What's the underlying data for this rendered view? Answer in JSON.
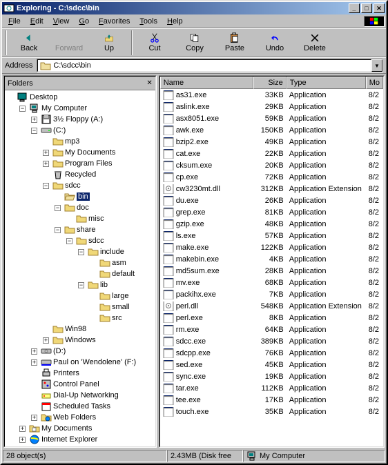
{
  "title": "Exploring - C:\\sdcc\\bin",
  "menu": [
    "File",
    "Edit",
    "View",
    "Go",
    "Favorites",
    "Tools",
    "Help"
  ],
  "tools": [
    {
      "name": "back",
      "label": "Back",
      "enabled": true
    },
    {
      "name": "forward",
      "label": "Forward",
      "enabled": false
    },
    {
      "name": "up",
      "label": "Up",
      "enabled": true
    },
    {
      "name": "cut",
      "label": "Cut",
      "enabled": true
    },
    {
      "name": "copy",
      "label": "Copy",
      "enabled": true
    },
    {
      "name": "paste",
      "label": "Paste",
      "enabled": true
    },
    {
      "name": "undo",
      "label": "Undo",
      "enabled": true
    },
    {
      "name": "delete",
      "label": "Delete",
      "enabled": true
    }
  ],
  "address_label": "Address",
  "address": "C:\\sdcc\\bin",
  "folders_label": "Folders",
  "cols": {
    "name": "Name",
    "size": "Size",
    "type": "Type",
    "mod": "Mo"
  },
  "tree": [
    {
      "d": 0,
      "exp": "",
      "ico": "desktop",
      "label": "Desktop"
    },
    {
      "d": 1,
      "exp": "-",
      "ico": "mycomp",
      "label": "My Computer"
    },
    {
      "d": 2,
      "exp": "+",
      "ico": "floppy",
      "label": "3½ Floppy (A:)"
    },
    {
      "d": 2,
      "exp": "-",
      "ico": "drive",
      "label": "(C:)"
    },
    {
      "d": 3,
      "exp": "",
      "ico": "fc",
      "label": "mp3"
    },
    {
      "d": 3,
      "exp": "+",
      "ico": "fc",
      "label": "My Documents"
    },
    {
      "d": 3,
      "exp": "+",
      "ico": "fc",
      "label": "Program Files"
    },
    {
      "d": 3,
      "exp": "",
      "ico": "recycle",
      "label": "Recycled"
    },
    {
      "d": 3,
      "exp": "-",
      "ico": "fc",
      "label": "sdcc"
    },
    {
      "d": 4,
      "exp": "",
      "ico": "fo",
      "label": "bin",
      "sel": true
    },
    {
      "d": 4,
      "exp": "-",
      "ico": "fc",
      "label": "doc"
    },
    {
      "d": 5,
      "exp": "",
      "ico": "fc",
      "label": "misc"
    },
    {
      "d": 4,
      "exp": "-",
      "ico": "fc",
      "label": "share"
    },
    {
      "d": 5,
      "exp": "-",
      "ico": "fc",
      "label": "sdcc"
    },
    {
      "d": 6,
      "exp": "-",
      "ico": "fc",
      "label": "include"
    },
    {
      "d": 7,
      "exp": "",
      "ico": "fc",
      "label": "asm"
    },
    {
      "d": 7,
      "exp": "",
      "ico": "fc",
      "label": "default"
    },
    {
      "d": 6,
      "exp": "-",
      "ico": "fc",
      "label": "lib"
    },
    {
      "d": 7,
      "exp": "",
      "ico": "fc",
      "label": "large"
    },
    {
      "d": 7,
      "exp": "",
      "ico": "fc",
      "label": "small"
    },
    {
      "d": 7,
      "exp": "",
      "ico": "fc",
      "label": "src"
    },
    {
      "d": 3,
      "exp": "",
      "ico": "fc",
      "label": "Win98"
    },
    {
      "d": 3,
      "exp": "+",
      "ico": "fc",
      "label": "Windows"
    },
    {
      "d": 2,
      "exp": "+",
      "ico": "cd",
      "label": "(D:)"
    },
    {
      "d": 2,
      "exp": "+",
      "ico": "net",
      "label": "Paul on 'Wendolene' (F:)"
    },
    {
      "d": 2,
      "exp": "",
      "ico": "printer",
      "label": "Printers"
    },
    {
      "d": 2,
      "exp": "",
      "ico": "cpl",
      "label": "Control Panel"
    },
    {
      "d": 2,
      "exp": "",
      "ico": "dun",
      "label": "Dial-Up Networking"
    },
    {
      "d": 2,
      "exp": "",
      "ico": "sched",
      "label": "Scheduled Tasks"
    },
    {
      "d": 2,
      "exp": "+",
      "ico": "webf",
      "label": "Web Folders"
    },
    {
      "d": 1,
      "exp": "+",
      "ico": "mydocs",
      "label": "My Documents"
    },
    {
      "d": 1,
      "exp": "+",
      "ico": "ie",
      "label": "Internet Explorer"
    }
  ],
  "files": [
    {
      "name": "as31.exe",
      "size": "33KB",
      "type": "Application",
      "mod": "8/2",
      "ico": "exe"
    },
    {
      "name": "aslink.exe",
      "size": "29KB",
      "type": "Application",
      "mod": "8/2",
      "ico": "exe"
    },
    {
      "name": "asx8051.exe",
      "size": "59KB",
      "type": "Application",
      "mod": "8/2",
      "ico": "exe"
    },
    {
      "name": "awk.exe",
      "size": "150KB",
      "type": "Application",
      "mod": "8/2",
      "ico": "exe"
    },
    {
      "name": "bzip2.exe",
      "size": "49KB",
      "type": "Application",
      "mod": "8/2",
      "ico": "exe"
    },
    {
      "name": "cat.exe",
      "size": "22KB",
      "type": "Application",
      "mod": "8/2",
      "ico": "exe"
    },
    {
      "name": "cksum.exe",
      "size": "20KB",
      "type": "Application",
      "mod": "8/2",
      "ico": "exe"
    },
    {
      "name": "cp.exe",
      "size": "72KB",
      "type": "Application",
      "mod": "8/2",
      "ico": "exe"
    },
    {
      "name": "cw3230mt.dll",
      "size": "312KB",
      "type": "Application Extension",
      "mod": "8/2",
      "ico": "dll"
    },
    {
      "name": "du.exe",
      "size": "26KB",
      "type": "Application",
      "mod": "8/2",
      "ico": "exe"
    },
    {
      "name": "grep.exe",
      "size": "81KB",
      "type": "Application",
      "mod": "8/2",
      "ico": "exe"
    },
    {
      "name": "gzip.exe",
      "size": "48KB",
      "type": "Application",
      "mod": "8/2",
      "ico": "exe"
    },
    {
      "name": "ls.exe",
      "size": "57KB",
      "type": "Application",
      "mod": "8/2",
      "ico": "exe"
    },
    {
      "name": "make.exe",
      "size": "122KB",
      "type": "Application",
      "mod": "8/2",
      "ico": "exe"
    },
    {
      "name": "makebin.exe",
      "size": "4KB",
      "type": "Application",
      "mod": "8/2",
      "ico": "exe"
    },
    {
      "name": "md5sum.exe",
      "size": "28KB",
      "type": "Application",
      "mod": "8/2",
      "ico": "exe"
    },
    {
      "name": "mv.exe",
      "size": "68KB",
      "type": "Application",
      "mod": "8/2",
      "ico": "exe"
    },
    {
      "name": "packihx.exe",
      "size": "7KB",
      "type": "Application",
      "mod": "8/2",
      "ico": "exe"
    },
    {
      "name": "perl.dll",
      "size": "548KB",
      "type": "Application Extension",
      "mod": "8/2",
      "ico": "dll"
    },
    {
      "name": "perl.exe",
      "size": "8KB",
      "type": "Application",
      "mod": "8/2",
      "ico": "exe"
    },
    {
      "name": "rm.exe",
      "size": "64KB",
      "type": "Application",
      "mod": "8/2",
      "ico": "exe"
    },
    {
      "name": "sdcc.exe",
      "size": "389KB",
      "type": "Application",
      "mod": "8/2",
      "ico": "exe"
    },
    {
      "name": "sdcpp.exe",
      "size": "76KB",
      "type": "Application",
      "mod": "8/2",
      "ico": "exe"
    },
    {
      "name": "sed.exe",
      "size": "45KB",
      "type": "Application",
      "mod": "8/2",
      "ico": "exe"
    },
    {
      "name": "sync.exe",
      "size": "19KB",
      "type": "Application",
      "mod": "8/2",
      "ico": "exe"
    },
    {
      "name": "tar.exe",
      "size": "112KB",
      "type": "Application",
      "mod": "8/2",
      "ico": "exe"
    },
    {
      "name": "tee.exe",
      "size": "17KB",
      "type": "Application",
      "mod": "8/2",
      "ico": "exe"
    },
    {
      "name": "touch.exe",
      "size": "35KB",
      "type": "Application",
      "mod": "8/2",
      "ico": "exe"
    }
  ],
  "status": {
    "objects": "28 object(s)",
    "disk": "2.43MB (Disk free",
    "loc": "My Computer"
  }
}
